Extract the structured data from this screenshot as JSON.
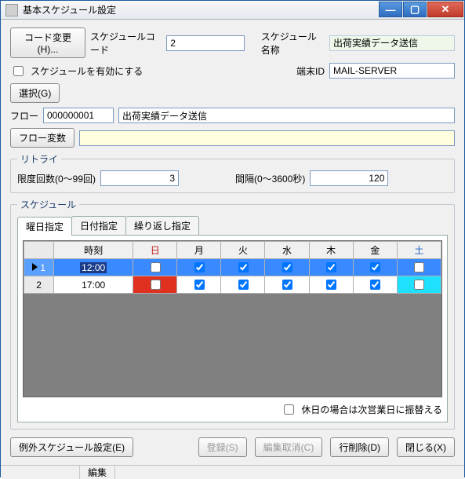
{
  "window": {
    "title": "基本スケジュール設定"
  },
  "form": {
    "code_change_btn": "コード変更(H)...",
    "schedule_code_label": "スケジュールコード",
    "schedule_code": "2",
    "schedule_name_label": "スケジュール名称",
    "schedule_name": "出荷実績データ送信",
    "enable_schedule_label": "スケジュールを有効にする",
    "enable_schedule": false,
    "terminal_id_label": "端末ID",
    "terminal_id": "MAIL-SERVER",
    "select_btn": "選択(G)",
    "flow_label": "フロー",
    "flow_code": "000000001",
    "flow_name": "出荷実績データ送信",
    "flow_vars_btn": "フロー変数"
  },
  "retry": {
    "legend": "リトライ",
    "limit_label": "限度回数(0～99回)",
    "limit_value": "3",
    "interval_label": "間隔(0～3600秒)",
    "interval_value": "120"
  },
  "schedule": {
    "legend": "スケジュール",
    "tabs": {
      "day_of_week": "曜日指定",
      "date": "日付指定",
      "repeat": "繰り返し指定"
    },
    "columns": {
      "time": "時刻",
      "sun": "日",
      "mon": "月",
      "tue": "火",
      "wed": "水",
      "thu": "木",
      "fri": "金",
      "sat": "土"
    },
    "rows": [
      {
        "num": "1",
        "time": "12:00",
        "days": [
          false,
          true,
          true,
          true,
          true,
          true,
          false
        ],
        "selected": true
      },
      {
        "num": "2",
        "time": "17:00",
        "days": [
          false,
          true,
          true,
          true,
          true,
          true,
          false
        ],
        "selected": false
      }
    ],
    "holiday_shift_label": "休日の場合は次営業日に振替える",
    "holiday_shift": false
  },
  "buttons": {
    "exception": "例外スケジュール設定(E)",
    "register": "登録(S)",
    "cancel_edit": "編集取消(C)",
    "delete_row": "行削除(D)",
    "close": "閉じる(X)"
  },
  "status": {
    "mode": "編集"
  }
}
